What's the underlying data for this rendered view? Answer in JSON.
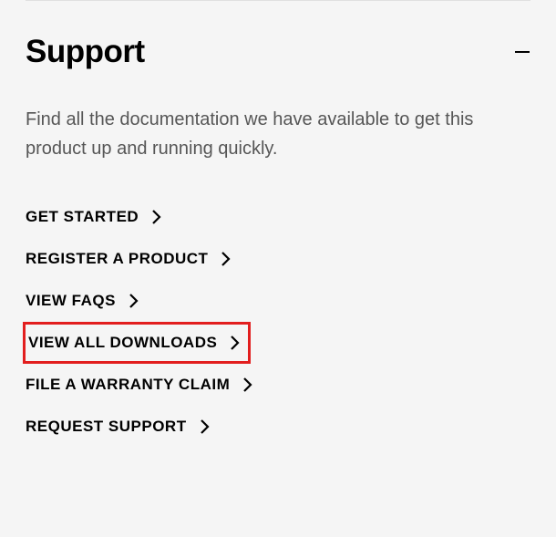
{
  "section": {
    "title": "Support",
    "description": "Find all the documentation we have available to get this product up and running quickly.",
    "links": [
      {
        "label": "GET STARTED",
        "highlighted": false
      },
      {
        "label": "REGISTER A PRODUCT",
        "highlighted": false
      },
      {
        "label": "VIEW FAQS",
        "highlighted": false
      },
      {
        "label": "VIEW ALL DOWNLOADS",
        "highlighted": true
      },
      {
        "label": "FILE A WARRANTY CLAIM",
        "highlighted": false
      },
      {
        "label": "REQUEST SUPPORT",
        "highlighted": false
      }
    ]
  }
}
